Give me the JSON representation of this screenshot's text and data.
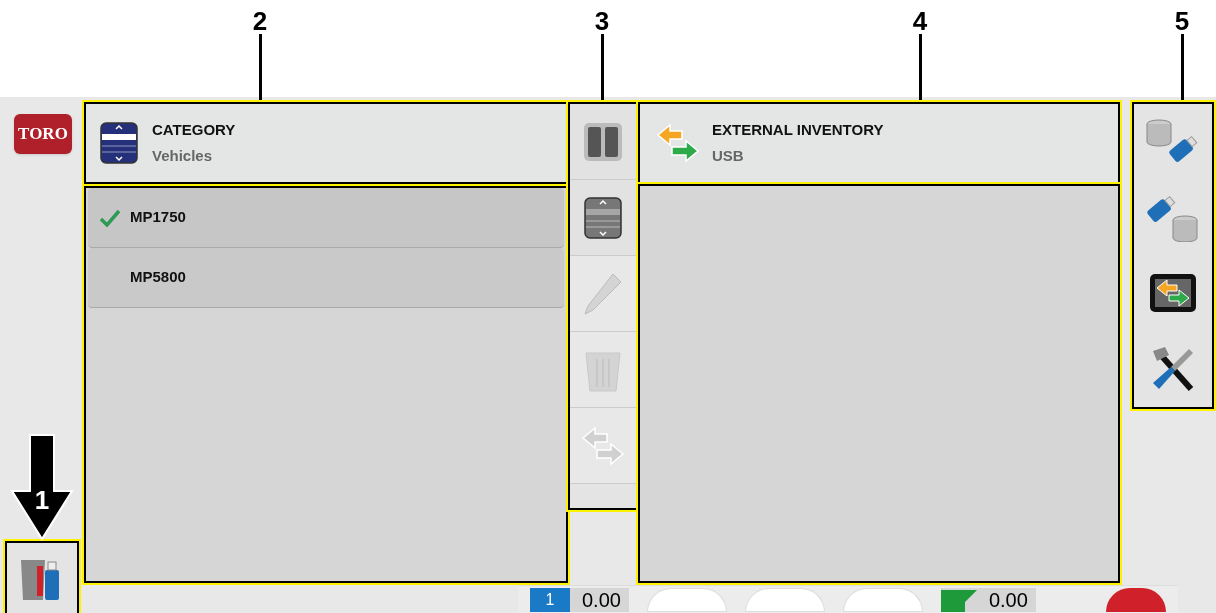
{
  "callouts": [
    {
      "label": "1"
    },
    {
      "label": "2"
    },
    {
      "label": "3"
    },
    {
      "label": "4"
    },
    {
      "label": "5"
    }
  ],
  "brand": {
    "logo": "TORO"
  },
  "category": {
    "title": "CATEGORY",
    "value": "Vehicles"
  },
  "items": [
    {
      "label": "MP1750",
      "selected": true
    },
    {
      "label": "MP5800",
      "selected": false
    }
  ],
  "toolbar": [
    {
      "kind": "split",
      "disabled": false
    },
    {
      "kind": "list",
      "disabled": false
    },
    {
      "kind": "edit",
      "disabled": true
    },
    {
      "kind": "delete",
      "disabled": true
    },
    {
      "kind": "transfer",
      "disabled": true
    }
  ],
  "external": {
    "title": "EXTERNAL INVENTORY",
    "value": "USB"
  },
  "actions": [
    {
      "kind": "export"
    },
    {
      "kind": "import"
    },
    {
      "kind": "transfer"
    },
    {
      "kind": "tools"
    }
  ],
  "status_bar": {
    "badge": "1",
    "reading_1": "0.00",
    "reading_2": "0.00"
  }
}
